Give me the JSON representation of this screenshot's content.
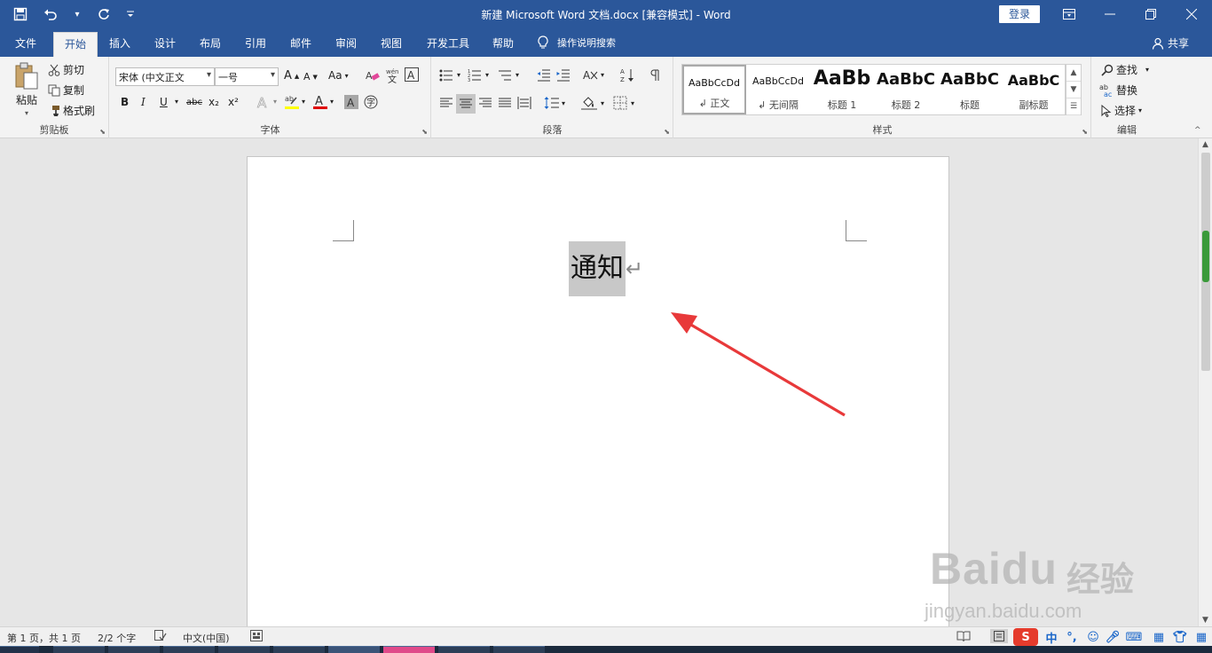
{
  "window": {
    "title": "新建 Microsoft Word 文档.docx [兼容模式] - Word",
    "login_label": "登录"
  },
  "tabs": [
    {
      "label": "文件"
    },
    {
      "label": "开始"
    },
    {
      "label": "插入"
    },
    {
      "label": "设计"
    },
    {
      "label": "布局"
    },
    {
      "label": "引用"
    },
    {
      "label": "邮件"
    },
    {
      "label": "审阅"
    },
    {
      "label": "视图"
    },
    {
      "label": "开发工具"
    },
    {
      "label": "帮助"
    }
  ],
  "tell_me": "操作说明搜索",
  "share": "共享",
  "ribbon": {
    "clipboard": {
      "label": "剪贴板",
      "paste": "粘贴",
      "cut": "剪切",
      "copy": "复制",
      "format_painter": "格式刷"
    },
    "font": {
      "label": "字体",
      "font_name": "宋体 (中文正文",
      "font_size": "一号",
      "change_case": "Aa",
      "bold": "B",
      "italic": "I",
      "underline": "U",
      "strike": "abc",
      "subscript": "x₂",
      "superscript": "x²"
    },
    "paragraph": {
      "label": "段落"
    },
    "styles": {
      "label": "样式",
      "items": [
        {
          "preview": "AaBbCcDd",
          "name": "↲ 正文"
        },
        {
          "preview": "AaBbCcDd",
          "name": "↲ 无间隔"
        },
        {
          "preview": "AaBb",
          "name": "标题 1"
        },
        {
          "preview": "AaBbC",
          "name": "标题 2"
        },
        {
          "preview": "AaBbC",
          "name": "标题"
        },
        {
          "preview": "AaBbC",
          "name": "副标题"
        }
      ]
    },
    "editing": {
      "label": "编辑",
      "find": "查找",
      "replace": "替换",
      "select": "选择"
    }
  },
  "document": {
    "text": "通知"
  },
  "statusbar": {
    "page": "第 1 页，共 1 页",
    "words": "2/2 个字",
    "language": "中文(中国)"
  },
  "ime": {
    "lang": "中"
  },
  "watermark": {
    "brand": "Baidu",
    "cn": "经验",
    "url": "jingyan.baidu.com"
  },
  "colors": {
    "word_blue": "#2b579a",
    "selection": "#c8c8c8",
    "arrow": "#e8393a"
  }
}
